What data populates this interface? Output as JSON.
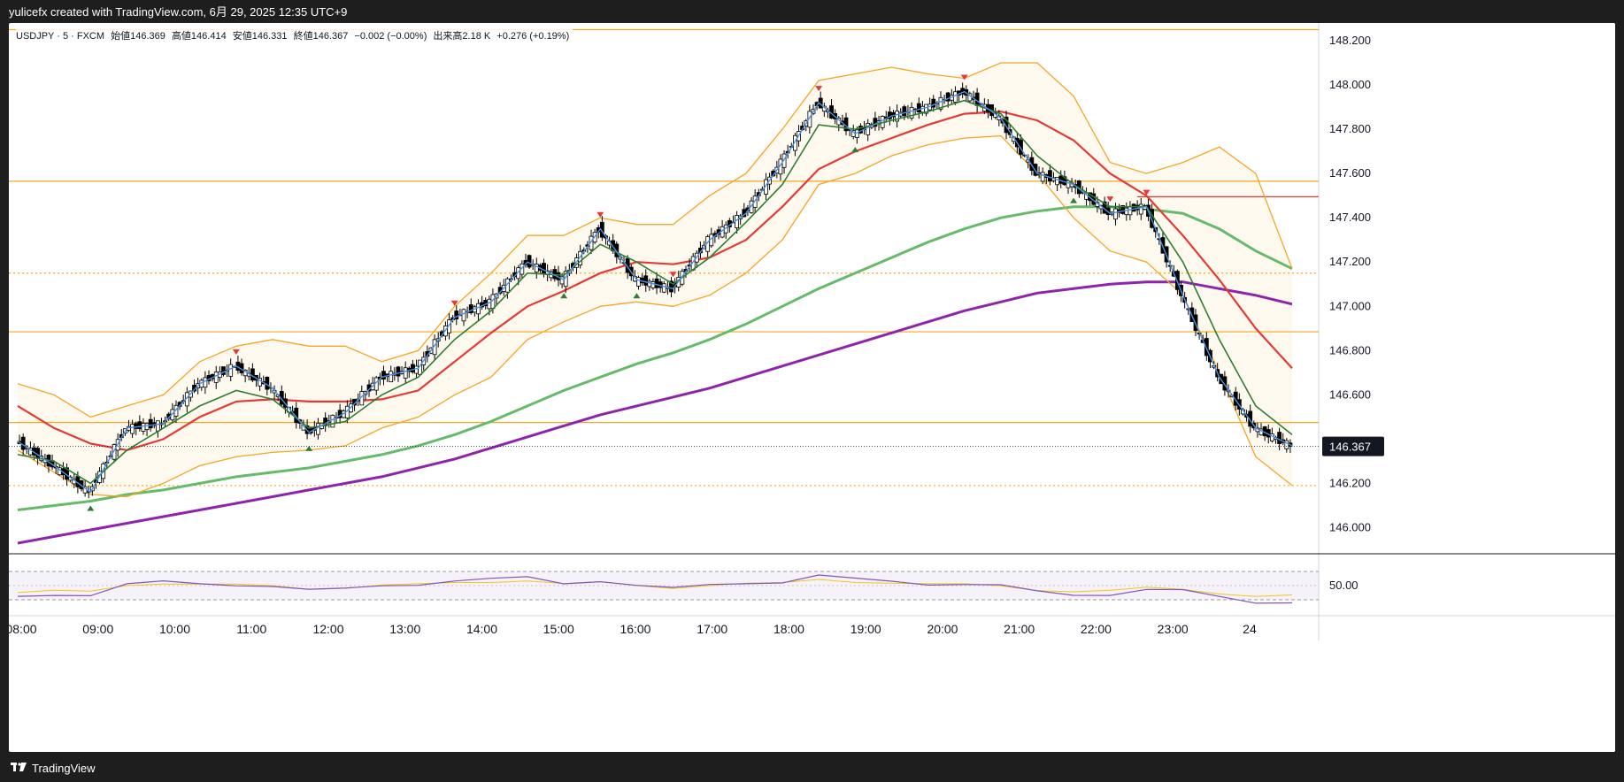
{
  "header": {
    "caption": "yulicefx created with TradingView.com, 6月 29, 2025 12:35 UTC+9"
  },
  "footer": {
    "brand": "TradingView"
  },
  "legend": {
    "symbol": "USDJPY · 5 · FXCM",
    "open": "始値146.369",
    "high": "高値146.414",
    "low": "安値146.331",
    "close": "終値146.367",
    "change": "−0.002 (−0.00%)",
    "volume": "出来高2.18 K",
    "volume_change": "+0.276 (+0.19%)"
  },
  "colors": {
    "bg": "#ffffff",
    "candle_up": "#ffffff",
    "candle_down": "#000000",
    "ma_fast": "#2e7d32",
    "ma_mid": "#e53935",
    "ma_slow": "#66bb6a",
    "ma_long": "#8e24aa",
    "bollinger": "#f5a623",
    "zigzag": "#4a90e2",
    "rsi": "#7e57c2",
    "rsi_signal": "#f5c518",
    "marker_up": "#2e7d32",
    "marker_down": "#e53935"
  },
  "chart_data": {
    "type": "candlestick",
    "title": "USDJPY · 5 · FXCM",
    "y_ticks": [
      "148.200",
      "148.000",
      "147.800",
      "147.600",
      "147.400",
      "147.200",
      "147.000",
      "146.800",
      "146.600",
      "146.200",
      "146.000"
    ],
    "ylim": [
      145.93,
      148.24
    ],
    "x_ticks": [
      "08:00",
      "09:00",
      "10:00",
      "11:00",
      "12:00",
      "13:00",
      "14:00",
      "15:00",
      "16:00",
      "17:00",
      "18:00",
      "19:00",
      "20:00",
      "21:00",
      "22:00",
      "23:00",
      "24"
    ],
    "last_price": "146.367",
    "rsi_tick": "50.00",
    "horizontal_levels": [
      {
        "value": 148.25,
        "style": "solid",
        "color": "#f5a623"
      },
      {
        "value": 147.565,
        "style": "solid",
        "color": "#f5a623"
      },
      {
        "value": 147.15,
        "style": "dotted",
        "color": "#f5a623"
      },
      {
        "value": 146.885,
        "style": "solid",
        "color": "#f5a623"
      },
      {
        "value": 146.475,
        "style": "solid",
        "color": "#f5a623"
      },
      {
        "value": 146.19,
        "style": "dotted",
        "color": "#f5a623"
      },
      {
        "value": 147.495,
        "style": "solid",
        "color": "#e53935"
      }
    ],
    "price_path": [
      {
        "t": "08:00",
        "v": 146.39
      },
      {
        "t": "08:30",
        "v": 146.28
      },
      {
        "t": "09:00",
        "v": 146.16
      },
      {
        "t": "09:30",
        "v": 146.45
      },
      {
        "t": "10:00",
        "v": 146.47
      },
      {
        "t": "10:30",
        "v": 146.65
      },
      {
        "t": "10:45",
        "v": 146.73
      },
      {
        "t": "11:00",
        "v": 146.63
      },
      {
        "t": "11:30",
        "v": 146.43
      },
      {
        "t": "12:00",
        "v": 146.52
      },
      {
        "t": "12:30",
        "v": 146.68
      },
      {
        "t": "13:00",
        "v": 146.72
      },
      {
        "t": "13:30",
        "v": 146.95
      },
      {
        "t": "14:00",
        "v": 147.02
      },
      {
        "t": "14:30",
        "v": 147.2
      },
      {
        "t": "15:00",
        "v": 147.12
      },
      {
        "t": "15:30",
        "v": 147.35
      },
      {
        "t": "16:00",
        "v": 147.12
      },
      {
        "t": "16:30",
        "v": 147.08
      },
      {
        "t": "17:00",
        "v": 147.3
      },
      {
        "t": "17:30",
        "v": 147.42
      },
      {
        "t": "18:00",
        "v": 147.65
      },
      {
        "t": "18:30",
        "v": 147.92
      },
      {
        "t": "18:45",
        "v": 147.78
      },
      {
        "t": "19:00",
        "v": 147.86
      },
      {
        "t": "19:30",
        "v": 147.9
      },
      {
        "t": "20:00",
        "v": 147.97
      },
      {
        "t": "20:30",
        "v": 147.85
      },
      {
        "t": "21:00",
        "v": 147.6
      },
      {
        "t": "21:30",
        "v": 147.55
      },
      {
        "t": "22:00",
        "v": 147.42
      },
      {
        "t": "22:30",
        "v": 147.45
      },
      {
        "t": "23:00",
        "v": 147.05
      },
      {
        "t": "23:30",
        "v": 146.68
      },
      {
        "t": "24:00",
        "v": 146.45
      },
      {
        "t": "24:30",
        "v": 146.37
      }
    ],
    "ma_fast": [
      146.33,
      146.3,
      146.2,
      146.35,
      146.45,
      146.55,
      146.62,
      146.58,
      146.45,
      146.48,
      146.6,
      146.68,
      146.85,
      146.98,
      147.15,
      147.14,
      147.28,
      147.2,
      147.1,
      147.22,
      147.38,
      147.55,
      147.82,
      147.8,
      147.84,
      147.88,
      147.93,
      147.87,
      147.68,
      147.55,
      147.45,
      147.45,
      147.2,
      146.85,
      146.55,
      146.42
    ],
    "ma_mid": [
      146.55,
      146.45,
      146.38,
      146.35,
      146.4,
      146.5,
      146.57,
      146.58,
      146.57,
      146.57,
      146.58,
      146.62,
      146.75,
      146.88,
      147.0,
      147.07,
      147.15,
      147.2,
      147.19,
      147.22,
      147.3,
      147.45,
      147.62,
      147.7,
      147.76,
      147.82,
      147.87,
      147.88,
      147.84,
      147.75,
      147.6,
      147.5,
      147.32,
      147.12,
      146.9,
      146.72
    ],
    "ma_slow": [
      146.08,
      146.1,
      146.12,
      146.15,
      146.17,
      146.2,
      146.23,
      146.25,
      146.27,
      146.3,
      146.33,
      146.37,
      146.42,
      146.48,
      146.55,
      146.62,
      146.68,
      146.74,
      146.79,
      146.85,
      146.92,
      147.0,
      147.08,
      147.15,
      147.22,
      147.29,
      147.35,
      147.4,
      147.43,
      147.45,
      147.45,
      147.44,
      147.42,
      147.35,
      147.25,
      147.17
    ],
    "ma_long": [
      145.93,
      145.96,
      145.99,
      146.02,
      146.05,
      146.08,
      146.11,
      146.14,
      146.17,
      146.2,
      146.23,
      146.27,
      146.31,
      146.36,
      146.41,
      146.46,
      146.51,
      146.55,
      146.59,
      146.63,
      146.68,
      146.73,
      146.78,
      146.83,
      146.88,
      146.93,
      146.98,
      147.02,
      147.06,
      147.08,
      147.1,
      147.11,
      147.11,
      147.08,
      147.05,
      147.01
    ],
    "bb_upper": [
      146.65,
      146.6,
      146.5,
      146.55,
      146.6,
      146.75,
      146.82,
      146.85,
      146.82,
      146.82,
      146.75,
      146.8,
      147.0,
      147.15,
      147.32,
      147.32,
      147.4,
      147.37,
      147.37,
      147.5,
      147.6,
      147.8,
      148.02,
      148.05,
      148.08,
      148.05,
      148.03,
      148.1,
      148.1,
      147.95,
      147.65,
      147.6,
      147.65,
      147.72,
      147.6,
      147.17
    ],
    "bb_lower": [
      146.35,
      146.25,
      146.15,
      146.14,
      146.2,
      146.28,
      146.32,
      146.34,
      146.35,
      146.37,
      146.45,
      146.5,
      146.6,
      146.68,
      146.85,
      146.93,
      147.0,
      147.02,
      147.0,
      147.05,
      147.15,
      147.3,
      147.55,
      147.6,
      147.68,
      147.73,
      147.76,
      147.77,
      147.6,
      147.4,
      147.25,
      147.2,
      147.05,
      146.7,
      146.32,
      146.19
    ]
  },
  "axis": {
    "last_price_label": "146.367",
    "rsi_label": "50.00"
  }
}
